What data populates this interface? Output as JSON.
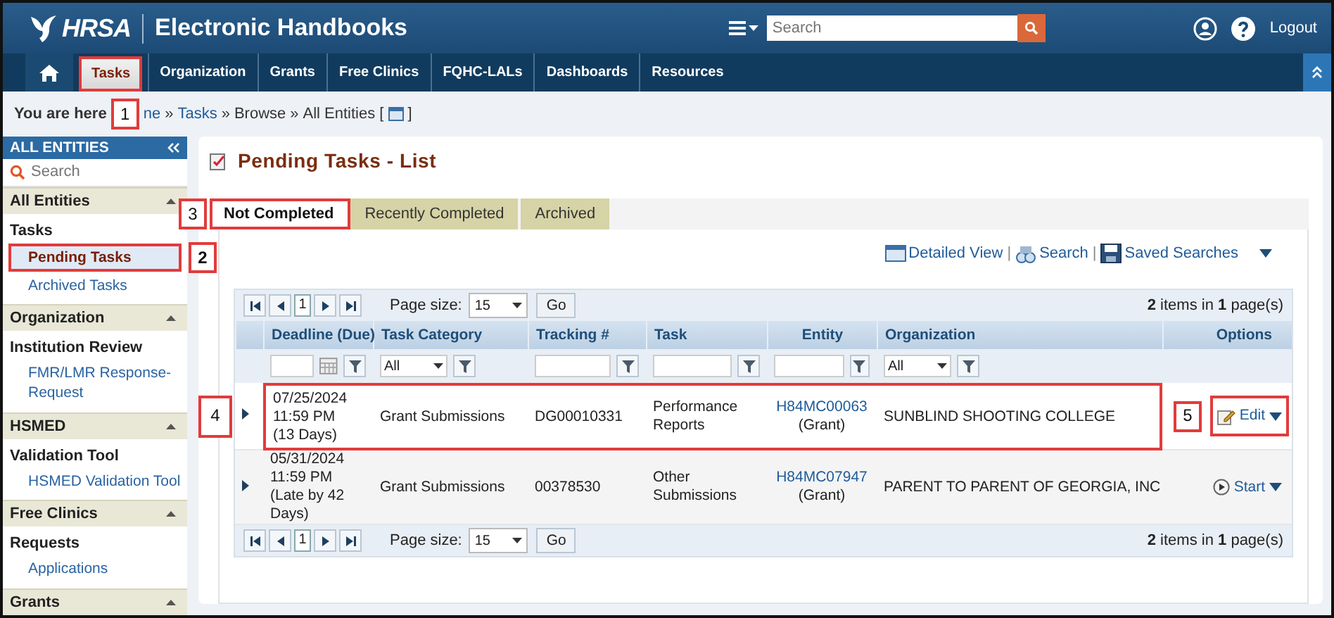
{
  "header": {
    "logo": "HRSA",
    "title": "Electronic Handbooks",
    "search": {
      "placeholder": "Search"
    },
    "logout": "Logout"
  },
  "nav": {
    "tabs": [
      {
        "label": "Tasks",
        "selected": true,
        "highlighted": true
      },
      {
        "label": "Organization",
        "selected": false,
        "highlighted": false
      },
      {
        "label": "Grants",
        "selected": false,
        "highlighted": false
      },
      {
        "label": "Free Clinics",
        "selected": false,
        "highlighted": false
      },
      {
        "label": "FQHC-LALs",
        "selected": false,
        "highlighted": false
      },
      {
        "label": "Dashboards",
        "selected": false,
        "highlighted": false
      },
      {
        "label": "Resources",
        "selected": false,
        "highlighted": false
      }
    ]
  },
  "callouts": [
    "1",
    "2",
    "3",
    "4",
    "5"
  ],
  "breadcrumb": {
    "prefix": "You are here",
    "items": [
      {
        "kind": "link",
        "text": "ne"
      },
      {
        "kind": "text",
        "text": "»"
      },
      {
        "kind": "link",
        "text": "Tasks"
      },
      {
        "kind": "text",
        "text": "»"
      },
      {
        "kind": "text",
        "text": "Browse"
      },
      {
        "kind": "text",
        "text": "»"
      },
      {
        "kind": "text",
        "text": "All Entities ["
      },
      {
        "kind": "icon"
      },
      {
        "kind": "text",
        "text": "]"
      }
    ]
  },
  "sidebar": {
    "title": "ALL ENTITIES",
    "search": {
      "placeholder": "Search"
    },
    "sections": [
      {
        "title": "All Entities",
        "expanded": true,
        "groups": [
          {
            "title": "Tasks",
            "items": [
              {
                "label": "Pending Tasks",
                "selected": true,
                "highlighted": true
              },
              {
                "label": "Archived Tasks",
                "selected": false,
                "highlighted": false
              }
            ]
          }
        ]
      },
      {
        "title": "Organization",
        "expanded": true,
        "groups": [
          {
            "title": "Institution Review",
            "items": [
              {
                "label": "FMR/LMR Response-Request",
                "selected": false,
                "highlighted": false
              }
            ]
          }
        ]
      },
      {
        "title": "HSMED",
        "expanded": true,
        "groups": [
          {
            "title": "Validation Tool",
            "items": [
              {
                "label": "HSMED Validation Tool",
                "selected": false,
                "highlighted": false
              }
            ]
          }
        ]
      },
      {
        "title": "Free Clinics",
        "expanded": true,
        "groups": [
          {
            "title": "Requests",
            "items": [
              {
                "label": "Applications",
                "selected": false,
                "highlighted": false
              }
            ]
          }
        ]
      },
      {
        "title": "Grants",
        "expanded": true
      }
    ]
  },
  "main": {
    "title": "Pending Tasks - List",
    "tabs": [
      {
        "label": "Not Completed",
        "selected": true,
        "highlighted": true
      },
      {
        "label": "Recently Completed",
        "selected": false,
        "highlighted": false
      },
      {
        "label": "Archived",
        "selected": false,
        "highlighted": false
      }
    ],
    "toolbar": [
      {
        "kind": "detail",
        "label": "Detailed View"
      },
      {
        "kind": "separator",
        "label": "|"
      },
      {
        "kind": "search",
        "label": "Search"
      },
      {
        "kind": "separator",
        "label": "|"
      },
      {
        "kind": "save",
        "label": "Saved Searches"
      }
    ],
    "pager_top": {
      "page": "1",
      "size_label": "Page size:",
      "size": "15",
      "go": "Go",
      "summary": "**2** items in **1** page(s)"
    },
    "columns": [
      "Deadline (Due)",
      "Task Category",
      "Tracking #",
      "Task",
      "Entity",
      "Organization",
      "Options"
    ],
    "filters": [
      {
        "kind": "date"
      },
      {
        "kind": "select",
        "value": "All"
      },
      {
        "kind": "text"
      },
      {
        "kind": "text"
      },
      {
        "kind": "text"
      },
      {
        "kind": "select",
        "value": "All"
      }
    ],
    "rows": [
      {
        "highlighted": true,
        "deadline": [
          "07/25/2024",
          "11:59 PM",
          "(13 Days)"
        ],
        "category": "Grant Submissions",
        "tracking": "DG00010331",
        "task": [
          "Performance",
          "Reports"
        ],
        "entity": {
          "code": "H84MC00063",
          "type": "(Grant)"
        },
        "organization": "SUNBLIND SHOOTING COLLEGE",
        "option": {
          "kind": "edit",
          "label": "Edit",
          "highlighted": true
        }
      },
      {
        "highlighted": false,
        "deadline": [
          "05/31/2024",
          "11:59 PM",
          "(Late by 42",
          "Days)"
        ],
        "category": "Grant Submissions",
        "tracking": "00378530",
        "task": [
          "Other",
          "Submissions"
        ],
        "entity": {
          "code": "H84MC07947",
          "type": "(Grant)"
        },
        "organization": "PARENT TO PARENT OF GEORGIA, INC",
        "option": {
          "kind": "start",
          "label": "Start",
          "highlighted": false
        }
      }
    ],
    "pager_bottom": {
      "page": "1",
      "size_label": "Page size:",
      "size": "15",
      "go": "Go",
      "summary": "**2** items in **1** page(s)"
    }
  }
}
